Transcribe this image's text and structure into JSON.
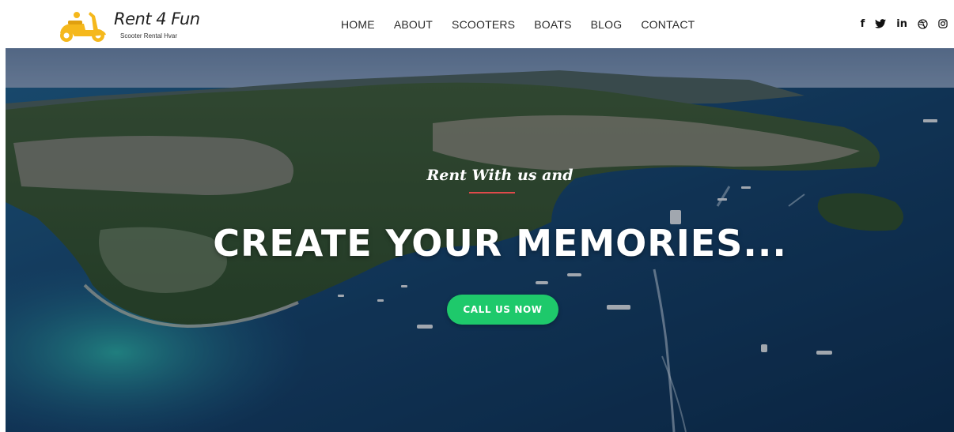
{
  "brand": {
    "name": "Rent 4 Fun",
    "tagline": "Scooter Rental Hvar",
    "icon": "scooter-logo-icon",
    "accent_color": "#f5b81c"
  },
  "nav": {
    "items": [
      {
        "label": "HOME"
      },
      {
        "label": "ABOUT"
      },
      {
        "label": "SCOOTERS"
      },
      {
        "label": "BOATS"
      },
      {
        "label": "BLOG"
      },
      {
        "label": "CONTACT"
      }
    ]
  },
  "social": [
    {
      "name": "facebook-icon",
      "label": "f"
    },
    {
      "name": "twitter-icon",
      "label": "twitter"
    },
    {
      "name": "linkedin-icon",
      "label": "in"
    },
    {
      "name": "dribbble-icon",
      "label": "dribbble"
    },
    {
      "name": "instagram-icon",
      "label": "instagram"
    }
  ],
  "hero": {
    "tagline": "Rent With us and",
    "headline": "CREATE YOUR MEMORIES...",
    "cta_label": "CALL US NOW",
    "cta_color": "#1ec96b",
    "divider_color": "#e04a4a"
  }
}
